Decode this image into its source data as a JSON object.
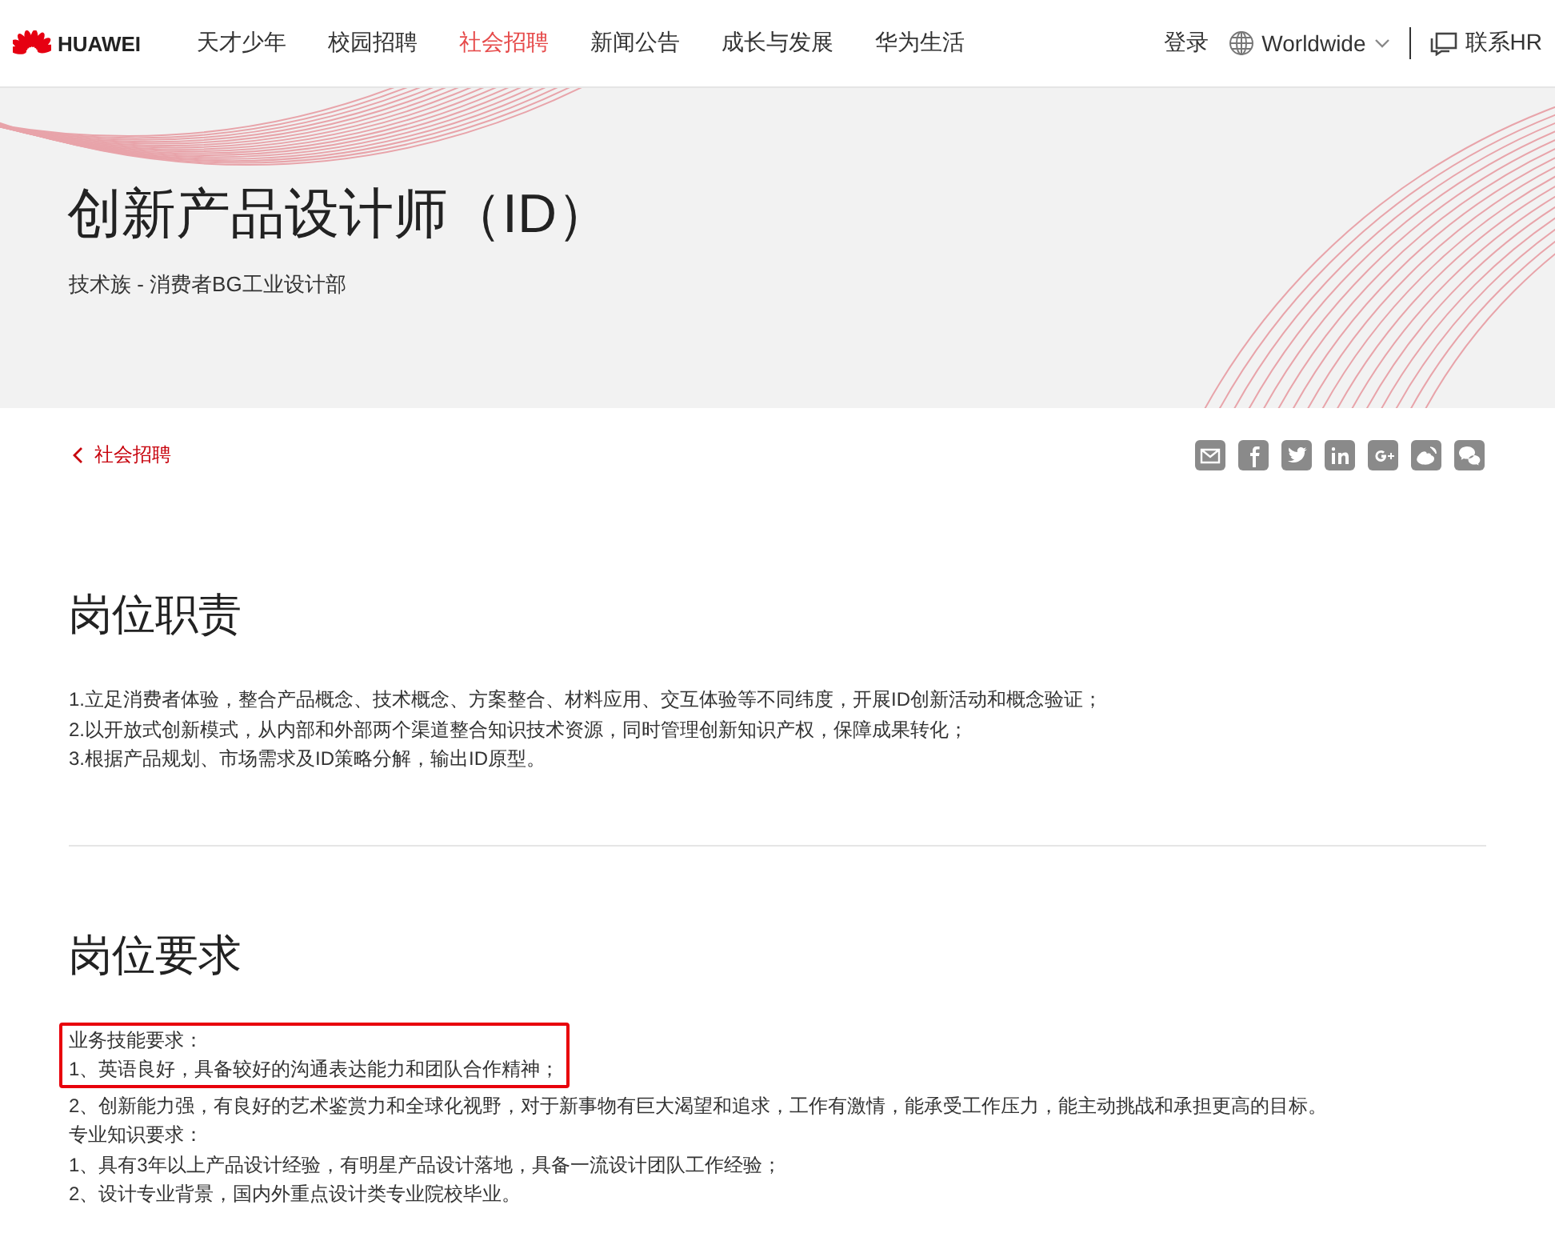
{
  "header": {
    "brand": "HUAWEI",
    "nav": [
      {
        "label": "天才少年",
        "selected": false
      },
      {
        "label": "校园招聘",
        "selected": false
      },
      {
        "label": "社会招聘",
        "selected": true
      },
      {
        "label": "新闻公告",
        "selected": false
      },
      {
        "label": "成长与发展",
        "selected": false
      },
      {
        "label": "华为生活",
        "selected": false
      }
    ],
    "login": "登录",
    "region": "Worldwide",
    "contact": "联系HR"
  },
  "hero": {
    "title": "创新产品设计师（ID）",
    "subtitle": "技术族 - 消费者BG工业设计部"
  },
  "back_link": "社会招聘",
  "share": [
    {
      "kind": "mail"
    },
    {
      "kind": "facebook"
    },
    {
      "kind": "twitter"
    },
    {
      "kind": "linkedin"
    },
    {
      "kind": "googleplus"
    },
    {
      "kind": "weibo"
    },
    {
      "kind": "wechat"
    }
  ],
  "sections": [
    {
      "title": "岗位职责",
      "blocks": [
        {
          "highlighted": false,
          "lines": [
            "1.立足消费者体验，整合产品概念、技术概念、方案整合、材料应用、交互体验等不同纬度，开展ID创新活动和概念验证；",
            "2.以开放式创新模式，从内部和外部两个渠道整合知识技术资源，同时管理创新知识产权，保障成果转化；",
            "3.根据产品规划、市场需求及ID策略分解，输出ID原型。"
          ]
        }
      ]
    },
    {
      "title": "岗位要求",
      "blocks": [
        {
          "highlighted": true,
          "lines": [
            "业务技能要求：",
            "1、英语良好，具备较好的沟通表达能力和团队合作精神；"
          ]
        },
        {
          "highlighted": false,
          "lines": [
            "2、创新能力强，有良好的艺术鉴赏力和全球化视野，对于新事物有巨大渴望和追求，工作有激情，能承受工作压力，能主动挑战和承担更高的目标。",
            "专业知识要求：",
            "1、具有3年以上产品设计经验，有明星产品设计落地，具备一流设计团队工作经验；",
            "2、设计专业背景，国内外重点设计类专业院校毕业。"
          ]
        }
      ]
    }
  ]
}
